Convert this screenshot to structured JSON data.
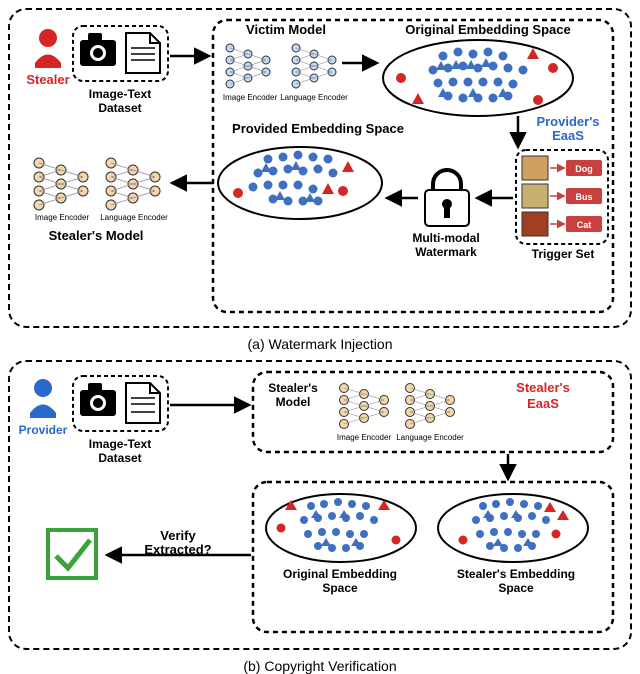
{
  "captions": {
    "a": "(a) Watermark Injection",
    "b": "(b) Copyright Verification"
  },
  "a": {
    "stealer": "Stealer",
    "dataset": "Image-Text\nDataset",
    "victim_model": "Victim Model",
    "orig_space": "Original Embedding Space",
    "img_enc": "Image Encoder",
    "lang_enc": "Language Encoder",
    "eaas": "Provider's\nEaaS",
    "trigger_set": "Trigger Set",
    "triggers": [
      {
        "img": "cat",
        "label": "Dog"
      },
      {
        "img": "dog",
        "label": "Bus"
      },
      {
        "img": "bus",
        "label": "Cat"
      }
    ],
    "watermark": "Multi-modal\nWatermark",
    "provided_space": "Provided Embedding Space",
    "stealer_model": "Stealer's Model"
  },
  "b": {
    "provider": "Provider",
    "dataset": "Image-Text\nDataset",
    "stealer_model": "Stealer's\nModel",
    "img_enc": "Image Encoder",
    "lang_enc": "Language Encoder",
    "eaas": "Stealer's\nEaaS",
    "orig_space": "Original Embedding\nSpace",
    "stealer_space": "Stealer's Embedding\nSpace",
    "verify": "Verify\nExtracted?"
  }
}
